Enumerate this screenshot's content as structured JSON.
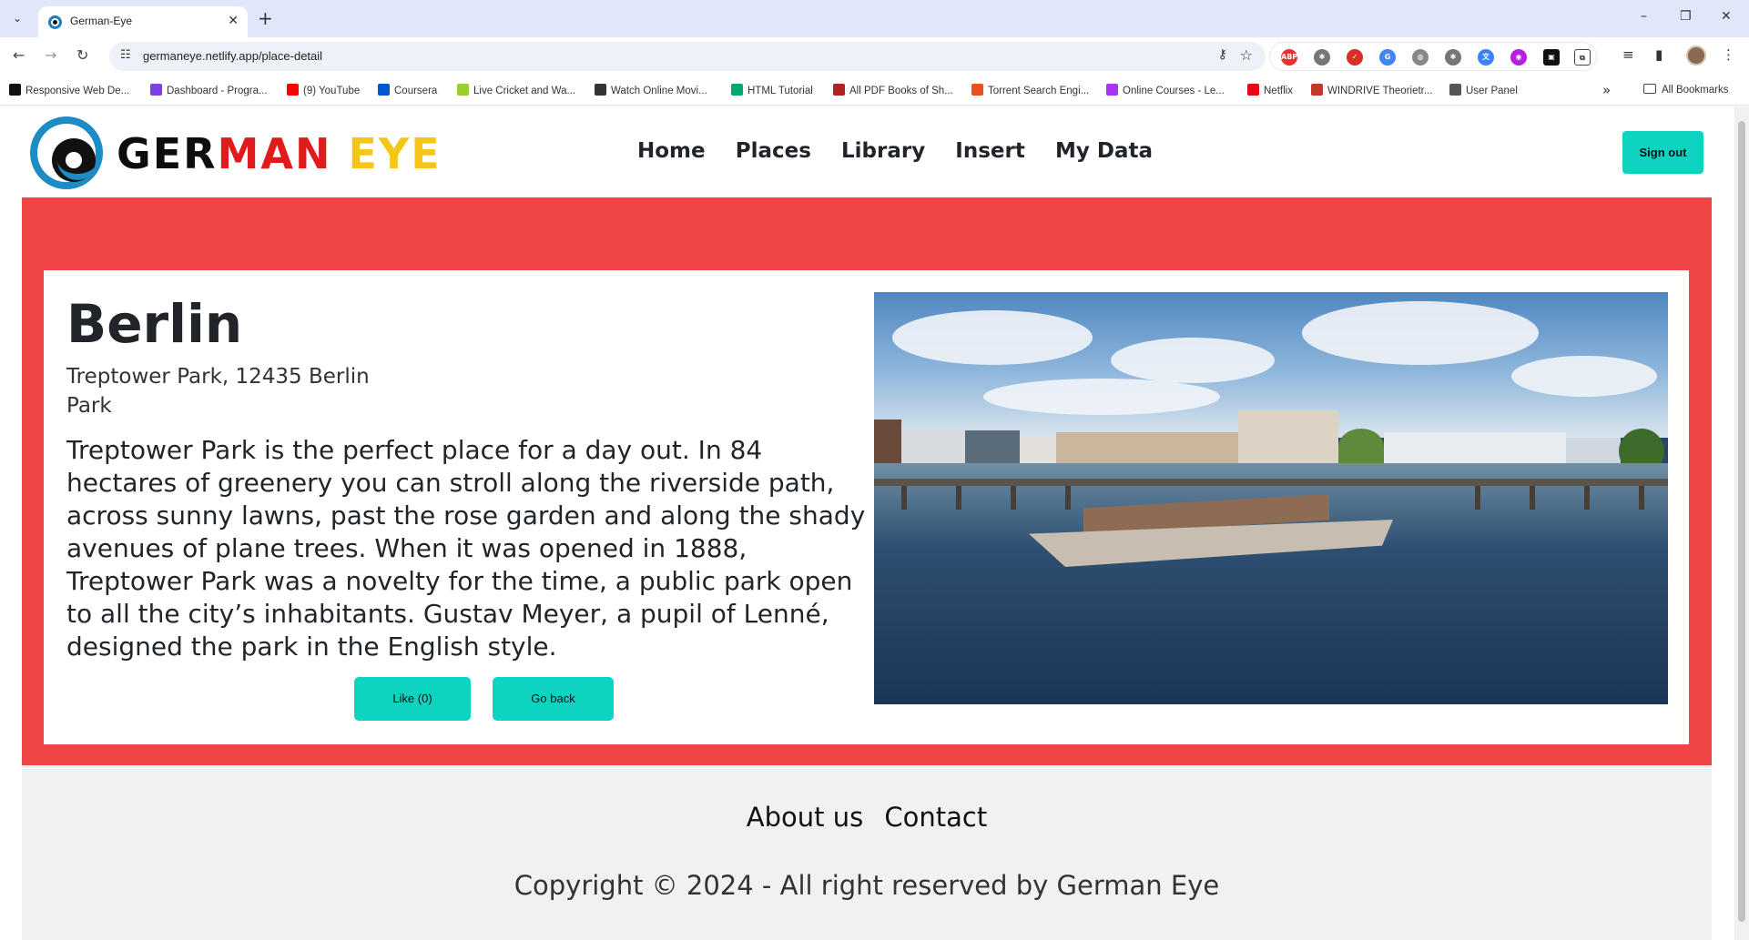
{
  "browser": {
    "tab_title": "German-Eye",
    "url": "germaneye.netlify.app/place-detail",
    "bookmarks": [
      {
        "label": "Responsive Web De...",
        "color": "#111111"
      },
      {
        "label": "Dashboard - Progra...",
        "color": "#7b3fe4"
      },
      {
        "label": "(9) YouTube",
        "color": "#ff0000"
      },
      {
        "label": "Coursera",
        "color": "#0056d2"
      },
      {
        "label": "Live Cricket and Wa...",
        "color": "#9acd32"
      },
      {
        "label": "Watch Online Movi...",
        "color": "#333333"
      },
      {
        "label": "HTML Tutorial",
        "color": "#04aa6d"
      },
      {
        "label": "All PDF Books of Sh...",
        "color": "#b22222"
      },
      {
        "label": "Torrent Search Engi...",
        "color": "#e8501f"
      },
      {
        "label": "Online Courses - Le...",
        "color": "#a435f0"
      },
      {
        "label": "Netflix",
        "color": "#e50914"
      },
      {
        "label": "WINDRIVE Theorietr...",
        "color": "#c0392b"
      },
      {
        "label": "User Panel",
        "color": "#555555"
      }
    ],
    "all_bookmarks": "All Bookmarks"
  },
  "site": {
    "logo": {
      "part1": "GER",
      "part2": "MAN",
      "part3": "EYE"
    },
    "nav": [
      "Home",
      "Places",
      "Library",
      "Insert",
      "My Data"
    ],
    "sign_out": "Sign out"
  },
  "place": {
    "title": "Berlin",
    "address": "Treptower Park, 12435 Berlin",
    "category": "Park",
    "description": "Treptower Park is the perfect place for a day out. In 84 hectares of greenery you can stroll along the riverside path, across sunny lawns, past the rose garden and along the shady avenues of plane trees. When it was opened in 1888, Treptower Park was a novelty for the time, a public park open to all the city’s inhabitants. Gustav Meyer, a pupil of Lenné, designed the park in the English style.",
    "like_button": "Like (0)",
    "back_button": "Go back"
  },
  "footer": {
    "about": "About us",
    "contact": "Contact",
    "copyright": "Copyright © 2024 - All right reserved by German Eye"
  },
  "colors": {
    "accent": "#0dd3c0",
    "band": "#ef4546",
    "logo_red": "#e01b1b",
    "logo_yellow": "#f5c518",
    "logo_ring": "#1d8cc4"
  }
}
